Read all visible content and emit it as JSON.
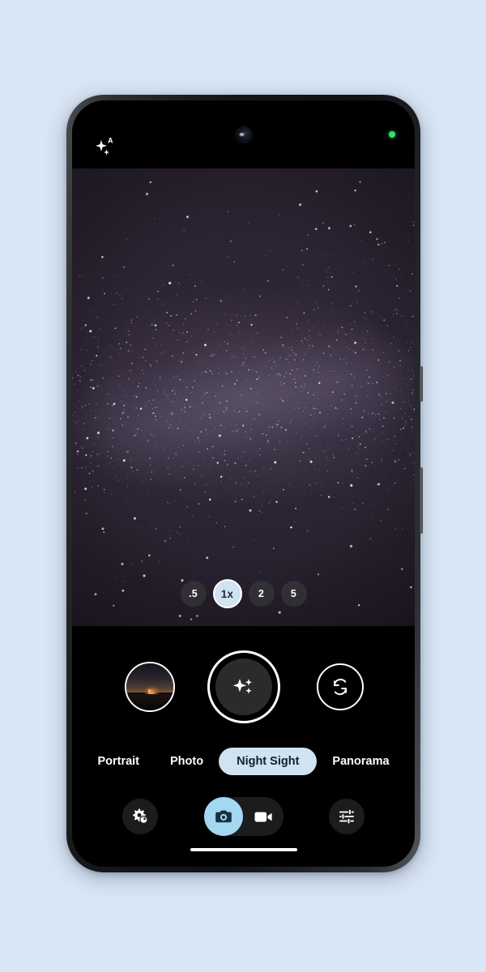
{
  "app": {
    "name": "Camera",
    "device": "smartphone",
    "background_color": "#d9e6f5",
    "frame_color": "#16171a"
  },
  "status_bar": {
    "auto_enhance_icon": "sparkles-auto-icon",
    "auto_enhance_badge_letter": "A",
    "front_camera_icon": "front-camera-punch-hole",
    "privacy_indicator_icon": "green-privacy-dot",
    "privacy_indicator_color": "#35dd6e"
  },
  "viewfinder": {
    "scene": "night-sky-milky-way",
    "base_color": "#2a2230",
    "zoom_levels": [
      {
        "label": ".5",
        "active": false
      },
      {
        "label": "1x",
        "active": true
      },
      {
        "label": "2",
        "active": false
      },
      {
        "label": "5",
        "active": false
      }
    ],
    "active_zoom": "1x",
    "accent_color": "#cfe3f2"
  },
  "shutter_row": {
    "gallery_thumbnail": {
      "icon": "gallery-thumbnail",
      "scene": "sunset-horizon"
    },
    "shutter": {
      "icon": "night-sight-sparkles-icon",
      "label": "Shutter"
    },
    "flip_camera": {
      "icon": "flip-camera-icon",
      "label": "Switch camera"
    }
  },
  "modes": [
    {
      "label": "Portrait",
      "active": false
    },
    {
      "label": "Photo",
      "active": false
    },
    {
      "label": "Night Sight",
      "active": true
    },
    {
      "label": "Panorama",
      "active": false
    }
  ],
  "bottom_bar": {
    "settings": {
      "icon": "settings-gear-timer-icon",
      "label": "Settings"
    },
    "capture_toggle": {
      "photo": {
        "icon": "photo-camera-icon",
        "active": true,
        "active_color": "#a4d7f2"
      },
      "video": {
        "icon": "video-camera-icon",
        "active": false
      }
    },
    "tune": {
      "icon": "tune-sliders-icon",
      "label": "Adjust"
    }
  },
  "system": {
    "home_indicator": "home-indicator-bar"
  }
}
